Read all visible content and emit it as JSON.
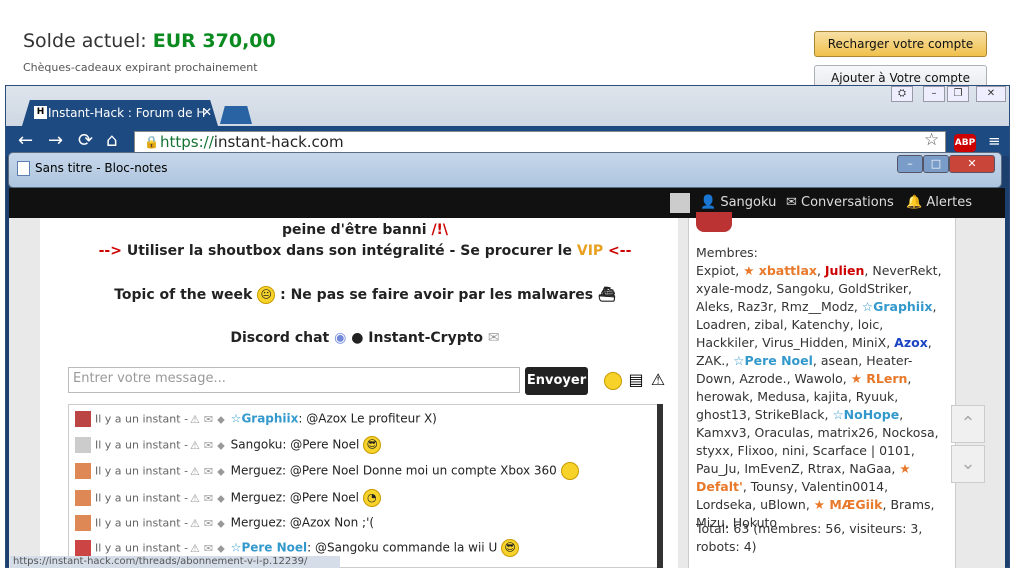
{
  "amazon": {
    "balance_label": "Solde actuel:",
    "balance_value": "EUR 370,00",
    "gift_note": "Chèques-cadeaux expirant prochainement",
    "recharge_btn": "Recharger votre compte",
    "add_btn": "Ajouter à Votre compte"
  },
  "chrome": {
    "tab_title": "Instant-Hack : Forum de H",
    "tab_fav": "H",
    "url_scheme": "https://",
    "url_host": "instant-hack.com",
    "abp": "ABP"
  },
  "notepad": {
    "title": "Sans titre - Bloc-notes"
  },
  "site": {
    "user": "Sangoku",
    "conversations": "Conversations",
    "alerts": "Alertes",
    "line1_text": "peine d'être banni",
    "line1_red": "/!\\",
    "line2_arrow1": "-->",
    "line2_text": "Utiliser la shoutbox dans son intégralité - Se procurer le",
    "line2_vip": "VIP",
    "line2_arrow2": "<--",
    "topic_label": "Topic of the week",
    "topic_text": ": Ne pas se faire avoir par les malwares",
    "discord": "Discord chat",
    "crypto": "● Instant-Crypto",
    "input_placeholder": "Entrer votre message...",
    "send_label": "Envoyer"
  },
  "shouts": [
    {
      "time": "Il y a un instant -",
      "user": "Graphiix",
      "msg": ": @Azox Le profiteur X)",
      "star": true
    },
    {
      "time": "Il y a un instant -",
      "user": "Sangoku",
      "msg": ": @Pere Noel",
      "star": false
    },
    {
      "time": "Il y a un instant -",
      "user": "Merguez",
      "msg": ": @Pere Noel Donne moi un compte Xbox 360",
      "star": false
    },
    {
      "time": "Il y a un instant -",
      "user": "Merguez",
      "msg": ": @Pere Noel",
      "star": false
    },
    {
      "time": "Il y a un instant -",
      "user": "Merguez",
      "msg": ": @Azox Non ;'(",
      "star": false
    },
    {
      "time": "Il y a un instant -",
      "user": "Pere Noel",
      "msg": ": @Sangoku commande la wii U",
      "star": true
    }
  ],
  "members": {
    "label": "Membres:",
    "total_line1": "Total: 63 (membres: 56, visiteurs: 3,",
    "total_line2": "robots: 4)"
  },
  "status_url": "https://instant-hack.com/threads/abonnement-v-i-p.12239/"
}
